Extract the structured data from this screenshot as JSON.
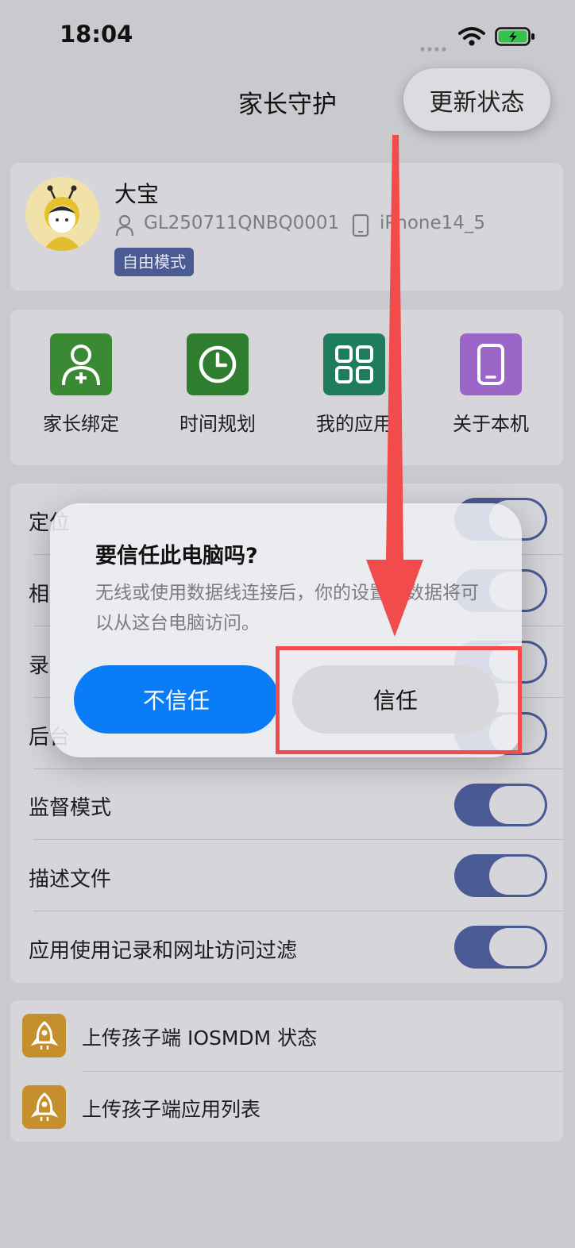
{
  "status_bar": {
    "time": "18:04",
    "signal_icon": "signal-dots-icon",
    "wifi_icon": "wifi-icon",
    "battery_icon": "battery-charging-icon"
  },
  "header": {
    "title": "家长守护",
    "update_button": "更新状态"
  },
  "profile": {
    "name": "大宝",
    "device_id": "GL250711QNBQ0001",
    "device_model": "iPhone14_5",
    "mode": "自由模式"
  },
  "shortcuts": [
    {
      "label": "家长绑定",
      "icon": "parent-bind-icon",
      "color": "#3a8a34"
    },
    {
      "label": "时间规划",
      "icon": "clock-icon",
      "color": "#2f7d2e"
    },
    {
      "label": "我的应用",
      "icon": "apps-grid-icon",
      "color": "#1f7d5e"
    },
    {
      "label": "关于本机",
      "icon": "phone-icon",
      "color": "#9b66c8"
    }
  ],
  "settings": [
    {
      "label": "定位",
      "on": true
    },
    {
      "label": "相",
      "on": true
    },
    {
      "label": "录",
      "on": true
    },
    {
      "label": "后台",
      "on": true
    },
    {
      "label": "监督模式",
      "on": true
    },
    {
      "label": "描述文件",
      "on": true
    },
    {
      "label": "应用使用记录和网址访问过滤",
      "on": true
    }
  ],
  "uploads": [
    {
      "label": "上传孩子端 IOSMDM 状态",
      "icon": "rocket-icon"
    },
    {
      "label": "上传孩子端应用列表",
      "icon": "rocket-icon"
    }
  ],
  "dialog": {
    "title": "要信任此电脑吗?",
    "body": "无线或使用数据线连接后，你的设置和数据将可以从这台电脑访问。",
    "distrust_button": "不信任",
    "trust_button": "信任"
  },
  "colors": {
    "accent_blue": "#0a7cf7",
    "toggle_on": "#4a5a95",
    "annotation_red": "#f24b4b",
    "badge": "#4a5b93"
  }
}
